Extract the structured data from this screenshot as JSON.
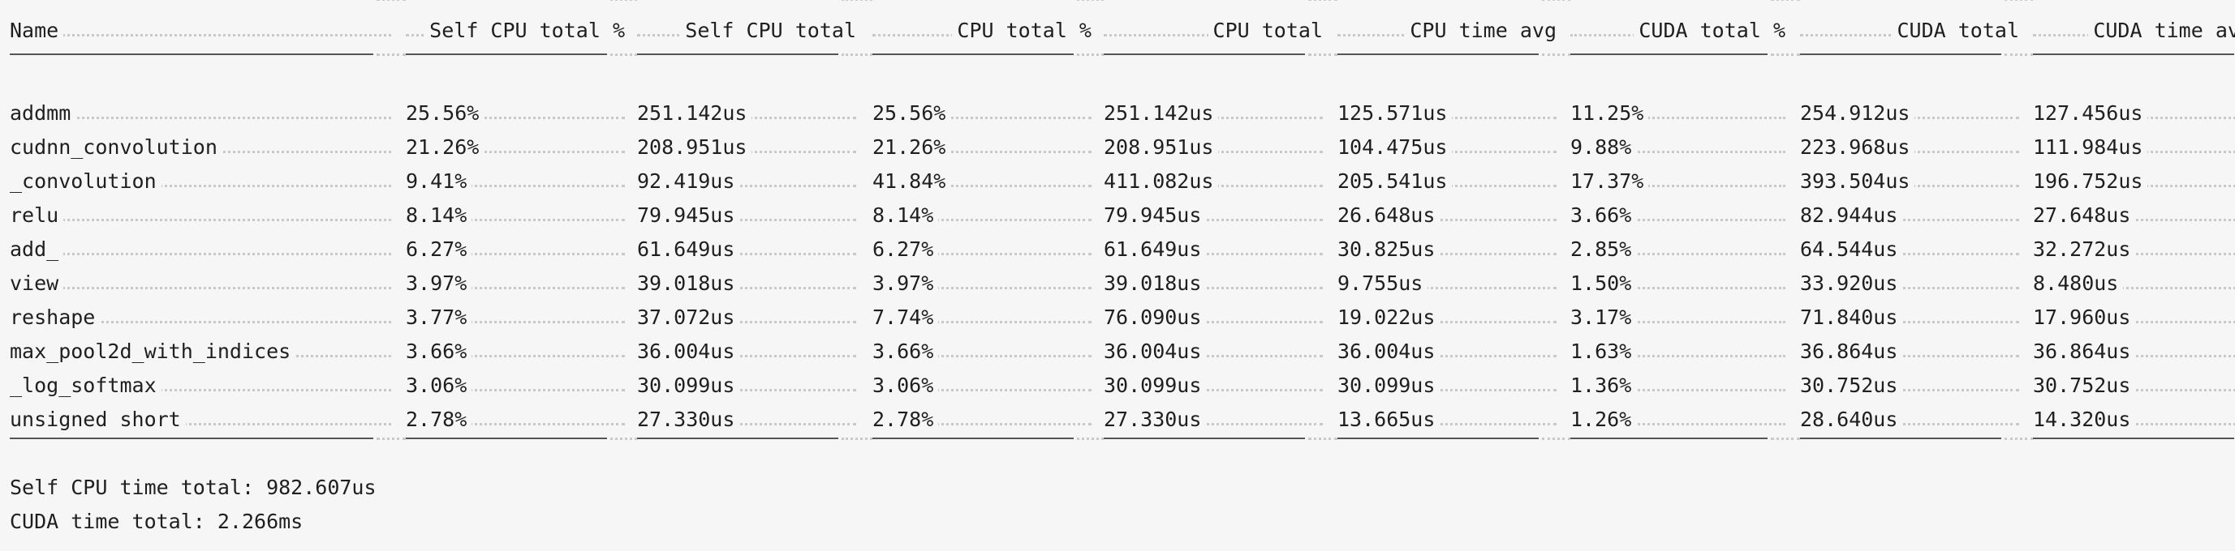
{
  "columns": [
    {
      "label": "Name"
    },
    {
      "label": "Self CPU total %"
    },
    {
      "label": "Self CPU total"
    },
    {
      "label": "CPU total %"
    },
    {
      "label": "CPU total"
    },
    {
      "label": "CPU time avg"
    },
    {
      "label": "CUDA total %"
    },
    {
      "label": "CUDA total"
    },
    {
      "label": "CUDA time avg"
    }
  ],
  "rows": [
    [
      "addmm",
      "25.56%",
      "251.142us",
      "25.56%",
      "251.142us",
      "125.571us",
      "11.25%",
      "254.912us",
      "127.456us"
    ],
    [
      "cudnn_convolution",
      "21.26%",
      "208.951us",
      "21.26%",
      "208.951us",
      "104.475us",
      "9.88%",
      "223.968us",
      "111.984us"
    ],
    [
      "_convolution",
      "9.41%",
      "92.419us",
      "41.84%",
      "411.082us",
      "205.541us",
      "17.37%",
      "393.504us",
      "196.752us"
    ],
    [
      "relu",
      "8.14%",
      "79.945us",
      "8.14%",
      "79.945us",
      "26.648us",
      "3.66%",
      "82.944us",
      "27.648us"
    ],
    [
      "add_",
      "6.27%",
      "61.649us",
      "6.27%",
      "61.649us",
      "30.825us",
      "2.85%",
      "64.544us",
      "32.272us"
    ],
    [
      "view",
      "3.97%",
      "39.018us",
      "3.97%",
      "39.018us",
      "9.755us",
      "1.50%",
      "33.920us",
      "8.480us"
    ],
    [
      "reshape",
      "3.77%",
      "37.072us",
      "7.74%",
      "76.090us",
      "19.022us",
      "3.17%",
      "71.840us",
      "17.960us"
    ],
    [
      "max_pool2d_with_indices",
      "3.66%",
      "36.004us",
      "3.66%",
      "36.004us",
      "36.004us",
      "1.63%",
      "36.864us",
      "36.864us"
    ],
    [
      "_log_softmax",
      "3.06%",
      "30.099us",
      "3.06%",
      "30.099us",
      "30.099us",
      "1.36%",
      "30.752us",
      "30.752us"
    ],
    [
      "unsigned short",
      "2.78%",
      "27.330us",
      "2.78%",
      "27.330us",
      "13.665us",
      "1.26%",
      "28.640us",
      "14.320us"
    ]
  ],
  "footer": {
    "self_cpu_time_total": "Self CPU time total: 982.607us",
    "cuda_time_total": "CUDA time total: 2.266ms"
  }
}
